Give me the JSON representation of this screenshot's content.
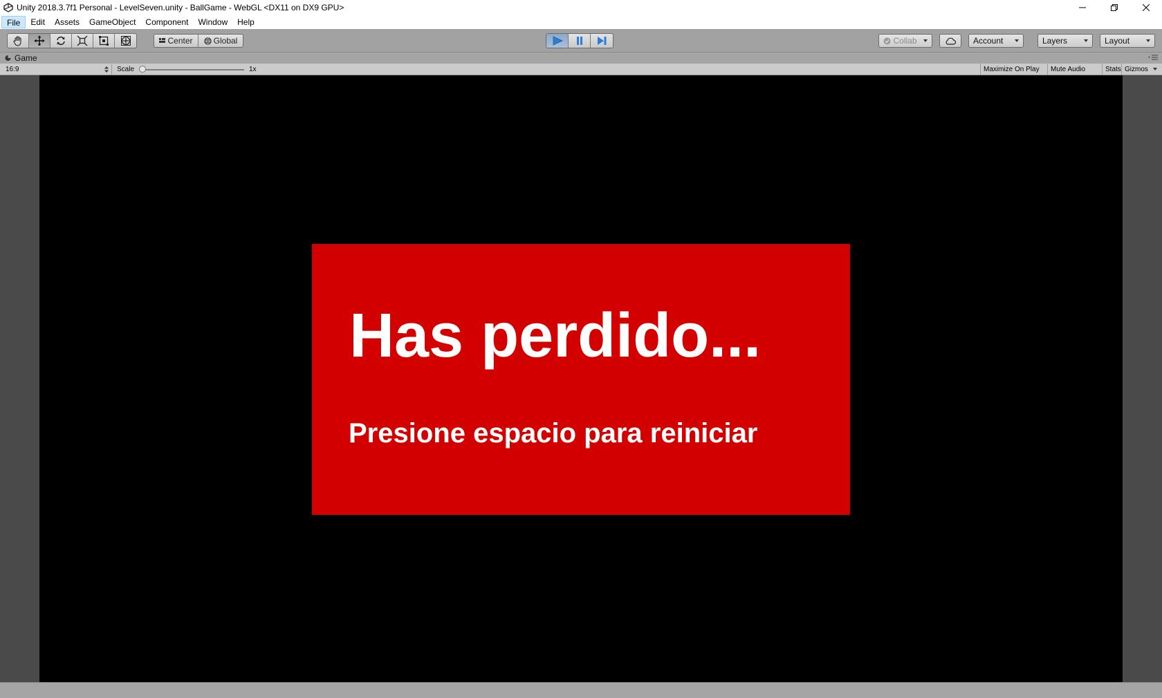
{
  "window": {
    "title": "Unity 2018.3.7f1 Personal - LevelSeven.unity - BallGame - WebGL <DX11 on DX9 GPU>"
  },
  "menu": {
    "items": [
      "File",
      "Edit",
      "Assets",
      "GameObject",
      "Component",
      "Window",
      "Help"
    ],
    "active": "File"
  },
  "toolbar": {
    "transform_tools": [
      "hand-tool",
      "move-tool",
      "rotate-tool",
      "scale-tool",
      "rect-tool",
      "transform-tool"
    ],
    "selected_tool": "move-tool",
    "pivot_label": "Center",
    "space_label": "Global",
    "playback": {
      "playing": true,
      "paused": false
    },
    "collab_label": "Collab",
    "account_label": "Account",
    "layers_label": "Layers",
    "layout_label": "Layout"
  },
  "game_tab": {
    "label": "Game"
  },
  "game_view": {
    "aspect": "16:9",
    "scale_label": "Scale",
    "scale_value": "1x",
    "scale_fraction": 0.0,
    "maximize_label": "Maximize On Play",
    "mute_label": "Mute Audio",
    "stats_label": "Stats",
    "gizmos_label": "Gizmos"
  },
  "game": {
    "title": "Has perdido...",
    "subtitle": "Presione espacio para reiniciar"
  },
  "colors": {
    "panel": "#d30000",
    "viewport": "#000000",
    "play_active": "#2d7ed8"
  }
}
